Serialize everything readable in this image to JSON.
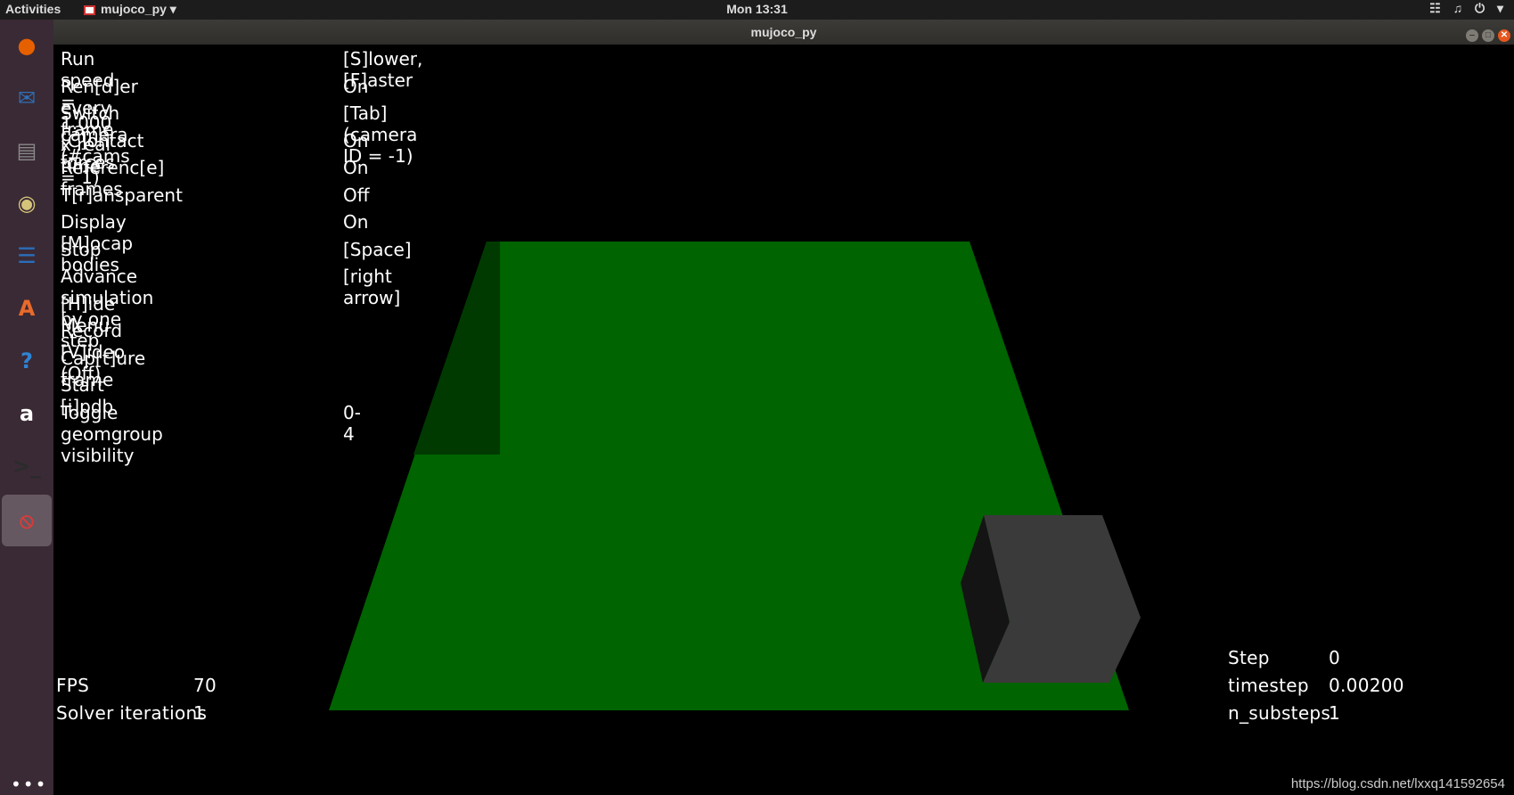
{
  "topbar": {
    "activities": "Activities",
    "app_name": "mujoco_py",
    "app_menu_arrow": "▾",
    "clock": "Mon 13:31",
    "tray_icons": [
      "network-icon",
      "volume-icon",
      "power-icon"
    ]
  },
  "window": {
    "title": "mujoco_py"
  },
  "dock": {
    "items": [
      {
        "name": "firefox-icon",
        "glyph": "●",
        "color": "#e66000"
      },
      {
        "name": "thunderbird-icon",
        "glyph": "✉",
        "color": "#2f6fb5"
      },
      {
        "name": "files-icon",
        "glyph": "▤",
        "color": "#8a8a8a"
      },
      {
        "name": "rhythmbox-icon",
        "glyph": "◉",
        "color": "#d4c47a"
      },
      {
        "name": "writer-icon",
        "glyph": "☰",
        "color": "#2a6ebb"
      },
      {
        "name": "software-center-icon",
        "glyph": "A",
        "color": "#e96a2b"
      },
      {
        "name": "help-icon",
        "glyph": "?",
        "color": "#2f84d2"
      },
      {
        "name": "amazon-icon",
        "glyph": "a",
        "color": "#ffffff"
      },
      {
        "name": "terminal-icon",
        "glyph": ">_",
        "color": "#2b2b2b"
      },
      {
        "name": "mujoco-window-icon",
        "glyph": "⦸",
        "color": "#d93b3b"
      }
    ],
    "show_apps": "•••"
  },
  "menu": {
    "rows": [
      {
        "label": "Run speed = 1.000 x real time",
        "value": "[S]lower, [F]aster"
      },
      {
        "label": "Ren[d]er every frame",
        "value": "On"
      },
      {
        "label": "Switch camera (#cams = 1)",
        "value": "[Tab] (camera ID = -1)"
      },
      {
        "label": "[C]ontact forces",
        "value": "On"
      },
      {
        "label": "Referenc[e] frames",
        "value": "On"
      },
      {
        "label": "T[r]ansparent",
        "value": "Off"
      },
      {
        "label": "Display [M]ocap bodies",
        "value": "On"
      },
      {
        "label": "Stop",
        "value": "[Space]"
      },
      {
        "label": "Advance simulation by one step",
        "value": "[right arrow]"
      },
      {
        "label": "[H]ide Menu",
        "value": ""
      },
      {
        "label": "Record [V]ideo (Off)",
        "value": ""
      },
      {
        "label": "Cap[t]ure frame",
        "value": ""
      },
      {
        "label": "Start [i]pdb",
        "value": ""
      },
      {
        "label": "Toggle geomgroup visibility",
        "value": "0-4"
      }
    ]
  },
  "stats_left": {
    "fps_label": "FPS",
    "fps_value": "70",
    "solver_label": "Solver iterations",
    "solver_value": "1"
  },
  "stats_right": {
    "step_label": "Step",
    "step_value": "0",
    "timestep_label": "timestep",
    "timestep_value": "0.00200",
    "nsubsteps_label": "n_substeps",
    "nsubsteps_value": "1"
  },
  "watermark": "https://blog.csdn.net/lxxq141592654",
  "colors": {
    "floor": "#006400",
    "floor_shadow": "#003a00",
    "box_face": "#3a3a3a",
    "box_side": "#141414"
  }
}
